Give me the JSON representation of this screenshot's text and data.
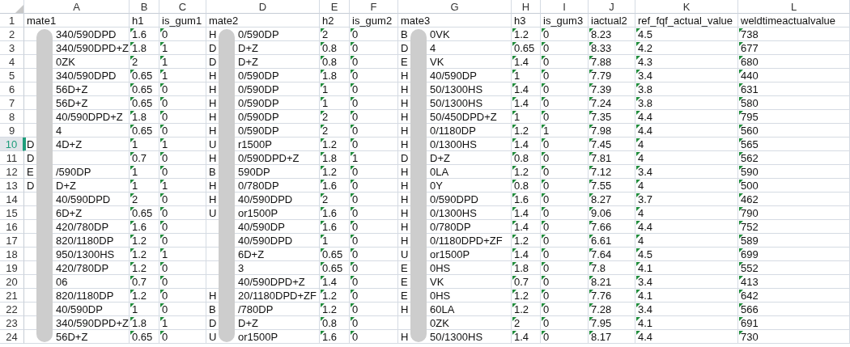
{
  "columns": [
    {
      "letter": "A",
      "kind": "masked"
    },
    {
      "letter": "B",
      "kind": "number"
    },
    {
      "letter": "C",
      "kind": "number"
    },
    {
      "letter": "D",
      "kind": "masked"
    },
    {
      "letter": "E",
      "kind": "number"
    },
    {
      "letter": "F",
      "kind": "number"
    },
    {
      "letter": "G",
      "kind": "masked"
    },
    {
      "letter": "H",
      "kind": "number"
    },
    {
      "letter": "I",
      "kind": "number"
    },
    {
      "letter": "J",
      "kind": "number"
    },
    {
      "letter": "K",
      "kind": "number"
    },
    {
      "letter": "L",
      "kind": "number"
    }
  ],
  "rows": [
    {
      "num": "1",
      "selected": false,
      "cells": [
        "mate1",
        "h1",
        "is_gum1",
        "mate2",
        "h2",
        "is_gum2",
        "mate3",
        "h3",
        "is_gum3",
        "iactual2",
        "ref_fqf_actual_value",
        "weldtimeactualvalue"
      ]
    },
    {
      "num": "2",
      "selected": false,
      "cells": [
        {
          "end": "340/590DPD"
        },
        "1.6",
        "0",
        {
          "start": "H",
          "end": "0/590DP"
        },
        "2",
        "0",
        {
          "start": "B",
          "end": "0VK"
        },
        "1.2",
        "0",
        "8.23",
        "4.5",
        "738"
      ]
    },
    {
      "num": "3",
      "selected": false,
      "cells": [
        {
          "end": "340/590DPD+Z"
        },
        "1.8",
        "1",
        {
          "start": "D",
          "end": "D+Z"
        },
        "0.8",
        "0",
        {
          "start": "D",
          "end": "4"
        },
        "0.65",
        "0",
        "8.33",
        "4.2",
        "677"
      ]
    },
    {
      "num": "4",
      "selected": false,
      "cells": [
        {
          "end": "0ZK"
        },
        "2",
        "1",
        {
          "start": "D",
          "end": "D+Z"
        },
        "0.8",
        "0",
        {
          "start": "E",
          "end": "VK"
        },
        "1.4",
        "0",
        "7.88",
        "4.3",
        "680"
      ]
    },
    {
      "num": "5",
      "selected": false,
      "cells": [
        {
          "end": "340/590DPD"
        },
        "0.65",
        "1",
        {
          "start": "H",
          "end": "0/590DP"
        },
        "1.8",
        "0",
        {
          "start": "H",
          "end": "40/590DP"
        },
        "1",
        "0",
        "7.79",
        "3.4",
        "440"
      ]
    },
    {
      "num": "6",
      "selected": false,
      "cells": [
        {
          "end": "56D+Z"
        },
        "0.65",
        "0",
        {
          "start": "H",
          "end": "0/590DP"
        },
        "1",
        "0",
        {
          "start": "H",
          "end": "50/1300HS"
        },
        "1.4",
        "0",
        "7.39",
        "3.8",
        "631"
      ]
    },
    {
      "num": "7",
      "selected": false,
      "cells": [
        {
          "end": "56D+Z"
        },
        "0.65",
        "0",
        {
          "start": "H",
          "end": "0/590DP"
        },
        "1",
        "0",
        {
          "start": "H",
          "end": "50/1300HS"
        },
        "1.4",
        "0",
        "7.24",
        "3.8",
        "580"
      ]
    },
    {
      "num": "8",
      "selected": false,
      "cells": [
        {
          "end": "40/590DPD+Z"
        },
        "1.8",
        "0",
        {
          "start": "H",
          "end": "0/590DP"
        },
        "2",
        "0",
        {
          "start": "H",
          "end": "50/450DPD+Z"
        },
        "1",
        "0",
        "7.35",
        "4.4",
        "795"
      ]
    },
    {
      "num": "9",
      "selected": false,
      "cells": [
        {
          "end": "4"
        },
        "0.65",
        "0",
        {
          "start": "H",
          "end": "0/590DP"
        },
        "2",
        "0",
        {
          "start": "H",
          "end": "0/1180DP"
        },
        "1.2",
        "1",
        "7.98",
        "4.4",
        "560"
      ]
    },
    {
      "num": "10",
      "selected": true,
      "cells": [
        {
          "start": "D",
          "end": "4D+Z"
        },
        "1",
        "1",
        {
          "start": "U",
          "end": "r1500P"
        },
        "1.2",
        "0",
        {
          "start": "H",
          "end": "0/1300HS"
        },
        "1.4",
        "0",
        "7.45",
        "4",
        "565"
      ]
    },
    {
      "num": "11",
      "selected": false,
      "cells": [
        {
          "start": "D"
        },
        "0.7",
        "0",
        {
          "start": "H",
          "end": "0/590DPD+Z"
        },
        "1.8",
        "1",
        {
          "start": "D",
          "end": "D+Z"
        },
        "0.8",
        "0",
        "7.81",
        "4",
        "562"
      ]
    },
    {
      "num": "12",
      "selected": false,
      "cells": [
        {
          "start": "E",
          "end": "/590DP"
        },
        "1",
        "0",
        {
          "start": "B",
          "end": "590DP"
        },
        "1.2",
        "0",
        {
          "start": "H",
          "end": "0LA"
        },
        "1.2",
        "0",
        "7.12",
        "3.4",
        "590"
      ]
    },
    {
      "num": "13",
      "selected": false,
      "cells": [
        {
          "start": "D",
          "end": "D+Z"
        },
        "1",
        "1",
        {
          "start": "H",
          "end": "0/780DP"
        },
        "1.6",
        "0",
        {
          "start": "H",
          "end": "0Y"
        },
        "0.8",
        "0",
        "7.55",
        "4",
        "500"
      ]
    },
    {
      "num": "14",
      "selected": false,
      "cells": [
        {
          "end": "40/590DPD"
        },
        "2",
        "0",
        {
          "start": "H",
          "end": "40/590DPD"
        },
        "2",
        "0",
        {
          "start": "H",
          "end": "0/590DPD"
        },
        "1.6",
        "0",
        "8.27",
        "3.7",
        "462"
      ]
    },
    {
      "num": "15",
      "selected": false,
      "cells": [
        {
          "end": "6D+Z"
        },
        "0.65",
        "0",
        {
          "start": "U",
          "end": "or1500P"
        },
        "1.6",
        "0",
        {
          "start": "H",
          "end": "0/1300HS"
        },
        "1.4",
        "0",
        "9.06",
        "4",
        "790"
      ]
    },
    {
      "num": "16",
      "selected": false,
      "cells": [
        {
          "end": "420/780DP"
        },
        "1.6",
        "0",
        {
          "end": "40/590DP"
        },
        "1.6",
        "0",
        {
          "start": "H",
          "end": "0/780DP"
        },
        "1.4",
        "0",
        "7.66",
        "4.4",
        "752"
      ]
    },
    {
      "num": "17",
      "selected": false,
      "cells": [
        {
          "end": "820/1180DP"
        },
        "1.2",
        "0",
        {
          "end": "40/590DPD"
        },
        "1",
        "0",
        {
          "start": "H",
          "end": "0/1180DPD+ZF"
        },
        "1.2",
        "0",
        "6.61",
        "4",
        "589"
      ]
    },
    {
      "num": "18",
      "selected": false,
      "cells": [
        {
          "end": "950/1300HS"
        },
        "1.2",
        "1",
        {
          "end": "6D+Z"
        },
        "0.65",
        "0",
        {
          "start": "U",
          "end": "or1500P"
        },
        "1.4",
        "0",
        "7.64",
        "4.5",
        "699"
      ]
    },
    {
      "num": "19",
      "selected": false,
      "cells": [
        {
          "end": "420/780DP"
        },
        "1.2",
        "0",
        {
          "end": "3"
        },
        "0.65",
        "0",
        {
          "start": "E",
          "end": "0HS"
        },
        "1.8",
        "0",
        "7.8",
        "4.1",
        "552"
      ]
    },
    {
      "num": "20",
      "selected": false,
      "cells": [
        {
          "end": "06"
        },
        "0.7",
        "0",
        {
          "end": "40/590DPD+Z"
        },
        "1.4",
        "0",
        {
          "start": "E",
          "end": "VK"
        },
        "0.7",
        "0",
        "8.21",
        "3.4",
        "413"
      ]
    },
    {
      "num": "21",
      "selected": false,
      "cells": [
        {
          "end": "820/1180DP"
        },
        "1.2",
        "0",
        {
          "start": "H",
          "end": "20/1180DPD+ZF"
        },
        "1.2",
        "0",
        {
          "start": "E",
          "end": "0HS"
        },
        "1.2",
        "0",
        "7.76",
        "4.1",
        "642"
      ]
    },
    {
      "num": "22",
      "selected": false,
      "cells": [
        {
          "end": "40/590DP"
        },
        "1",
        "0",
        {
          "start": "B",
          "end": "/780DP"
        },
        "1.2",
        "0",
        {
          "start": "H",
          "end": "60LA"
        },
        "1.2",
        "0",
        "7.28",
        "3.4",
        "566"
      ]
    },
    {
      "num": "23",
      "selected": false,
      "cells": [
        {
          "end": "340/590DPD+Z"
        },
        "1.8",
        "1",
        {
          "start": "D",
          "end": "D+Z"
        },
        "0.8",
        "0",
        {
          "end": "0ZK"
        },
        "2",
        "0",
        "7.95",
        "4.1",
        "691"
      ]
    },
    {
      "num": "24",
      "selected": false,
      "cells": [
        {
          "end": "56D+Z"
        },
        "0.65",
        "0",
        {
          "start": "U",
          "end": "or1500P"
        },
        "1.6",
        "0",
        {
          "start": "H",
          "end": "50/1300HS"
        },
        "1.4",
        "0",
        "8.17",
        "4.4",
        "730"
      ]
    }
  ]
}
